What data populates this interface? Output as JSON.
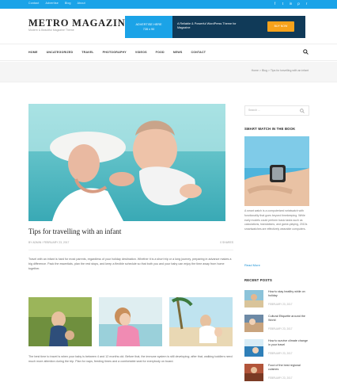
{
  "topbar": {
    "links": [
      "Contact",
      "Advertise",
      "Blog",
      "About"
    ],
    "social_icons": [
      "facebook-icon",
      "twitter-icon",
      "linkedin-icon",
      "pinterest-icon",
      "rss-icon"
    ],
    "color": "#1aa3e8"
  },
  "header": {
    "logo": "METRO MAGAZINE",
    "tagline": "Modern & Beautiful Magazine Theme"
  },
  "ad": {
    "left_line1": "ADVERTISE HERE",
    "left_line2": "728 x 90",
    "text": "A Reliable & Powerful WordPress Theme for Magazine",
    "button": "BUY NOW",
    "accent": "#1ba3e7",
    "dark": "#103a58",
    "button_color": "#f7a21b"
  },
  "nav": {
    "items": [
      "HOME",
      "UNCATEGORIZED",
      "TRAVEL",
      "PHOTOGRAPHY",
      "VIDEOS",
      "FOOD",
      "NEWS",
      "CONTACT"
    ]
  },
  "breadcrumb": "Home  >  Blog  >  Tips for travelling with an infant",
  "post": {
    "title": "Tips for travelling with an infant",
    "meta_left": "BY ADMIN   /   FEBRUARY 23, 2017",
    "meta_right": "0 SHARES",
    "body1": "Travel with an infant is hard for most parents, regardless of your holiday destination. Whether it is a short trip or a long journey, preparing in advance makes a big difference. Pack the essentials, plan the rest stops, and keep a flexible schedule so that both you and your baby can enjoy the time away from home together.",
    "body2": "The best time to travel is when your baby is between 4 and 12 months old. Before that, the immune system is still developing; after that, walking toddlers need much more attention during the trip. Plan for naps, feeding times and a comfortable seat for everybody on board."
  },
  "sidebar": {
    "search_placeholder": "Search ...",
    "smart_title": "SMART WATCH IN THE BOOK",
    "smart_text": "A smart watch is a computerized wristwatch with functionality that goes beyond timekeeping. While early models could perform basic tasks such as calculations, translations, and game-playing, 2010s smartwatches are effectively wearable computers.",
    "read_more": "Read More",
    "recent_title": "RECENT POSTS",
    "recent": [
      {
        "title": "How to stay healthy while on holiday",
        "date": "FEBRUARY 23, 2017"
      },
      {
        "title": "Cultural Etiquette around the World",
        "date": "FEBRUARY 23, 2017"
      },
      {
        "title": "How to survive climate change in your travel",
        "date": "FEBRUARY 23, 2017"
      },
      {
        "title": "Food of the best regional cuisines",
        "date": "FEBRUARY 23, 2017"
      }
    ]
  }
}
